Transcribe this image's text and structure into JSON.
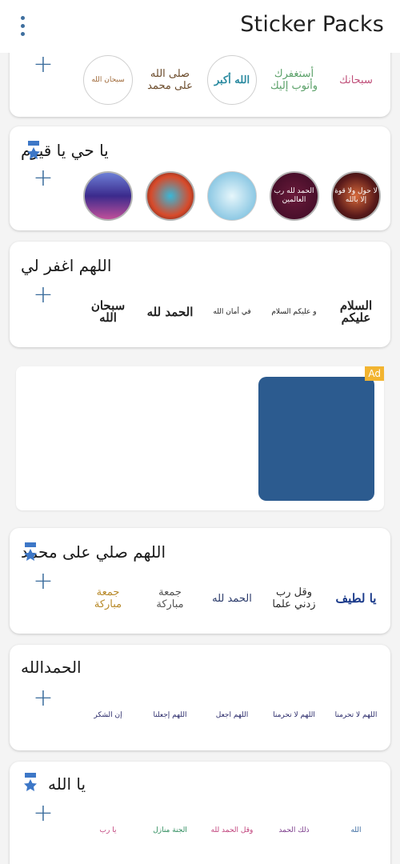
{
  "header": {
    "title": "Sticker Packs",
    "menu_icon": "overflow-menu-icon"
  },
  "colors": {
    "accent": "#3a6c9c",
    "badge": "#3d77c7",
    "ad_tag": "#f2b430",
    "ad_image": "#2c5b8f"
  },
  "packs": [
    {
      "name": "",
      "add_label": "+",
      "stickers": [
        "أستغفرك وأتوب إليك",
        "سبحان الله",
        "الله أكبر",
        "صلى الله على محمد",
        "سبحانك"
      ]
    },
    {
      "name": "يا حي يا قيوم",
      "add_label": "+",
      "stickers": [
        "لا حول ولا قوة إلا بالله",
        "الحمد لله رب العالمين",
        "",
        "",
        ""
      ]
    },
    {
      "name": "اللهم اغفر لي",
      "add_label": "+",
      "stickers": [
        "السلام عليكم",
        "و عليكم السلام",
        "في أمان الله",
        "الحمد لله",
        "سبحان الله"
      ]
    },
    {
      "name": "اللهم صلي على محمد",
      "add_label": "+",
      "stickers": [
        "يا لطيف",
        "وقل رب زدني علما",
        "الحمد لله",
        "جمعة مباركة",
        "جمعة مباركة"
      ]
    },
    {
      "name": "الحمدالله",
      "add_label": "+",
      "stickers": [
        "اللهم لا تحرمنا",
        "اللهم لا تحرمنا",
        "اللهم اجعل",
        "اللهم إجعلنا",
        "إن الشكر"
      ]
    },
    {
      "name": "يا الله",
      "add_label": "+",
      "stickers": [
        "الله",
        "ذلك الحمد",
        "وقل الحمد لله",
        "الجنة منازل",
        "يا رب"
      ]
    }
  ],
  "ad": {
    "label": "Ad"
  }
}
